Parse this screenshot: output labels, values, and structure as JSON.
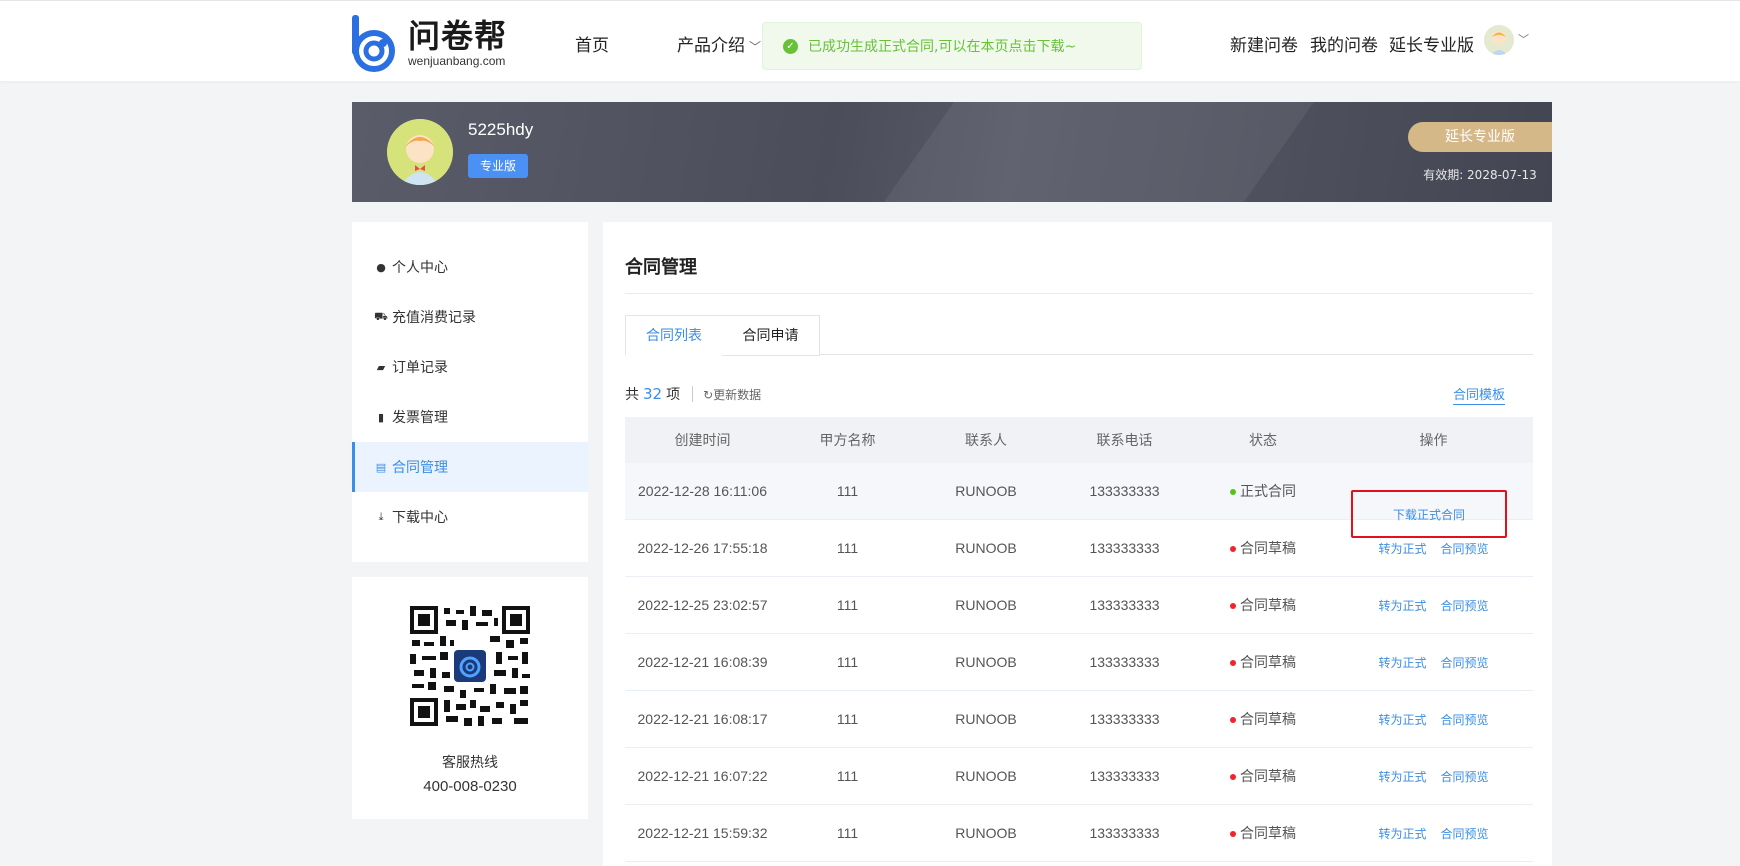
{
  "brand": {
    "name": "问卷帮",
    "domain": "wenjuanbang.com",
    "color": "#2b6fe0"
  },
  "nav": {
    "home": "首页",
    "product": "产品介绍",
    "new_survey": "新建问卷",
    "my_survey": "我的问卷",
    "extend_pro": "延长专业版"
  },
  "toast": {
    "message": "已成功生成正式合同,可以在本页点击下载~",
    "icon": "check-circle-icon",
    "color": "#67c23a"
  },
  "banner": {
    "username": "5225hdy",
    "badge": "专业版",
    "extend_button": "延长专业版",
    "validity": "有效期:  2028-07-13"
  },
  "sidebar": {
    "items": [
      {
        "label": "个人中心",
        "icon": "user-icon"
      },
      {
        "label": "充值消费记录",
        "icon": "cart-icon"
      },
      {
        "label": "订单记录",
        "icon": "ticket-icon"
      },
      {
        "label": "发票管理",
        "icon": "clipboard-icon"
      },
      {
        "label": "合同管理",
        "icon": "document-icon",
        "active": true
      },
      {
        "label": "下载中心",
        "icon": "download-icon"
      }
    ]
  },
  "support": {
    "label": "客服热线",
    "phone": "400-008-0230"
  },
  "main": {
    "title": "合同管理",
    "tabs": [
      {
        "label": "合同列表",
        "active": true
      },
      {
        "label": "合同申请"
      }
    ],
    "summary_prefix": "共",
    "summary_count": "32",
    "summary_suffix": "项",
    "refresh": "更新数据",
    "template_link": "合同模板",
    "columns": [
      "创建时间",
      "甲方名称",
      "联系人",
      "联系电话",
      "状态",
      "操作"
    ],
    "rows": [
      {
        "time": "2022-12-28 16:11:06",
        "party": "111",
        "contact": "RUNOOB",
        "phone": "133333333",
        "status": "正式合同",
        "status_color": "#52c41a",
        "actions": [
          "下载正式合同"
        ]
      },
      {
        "time": "2022-12-26 17:55:18",
        "party": "111",
        "contact": "RUNOOB",
        "phone": "133333333",
        "status": "合同草稿",
        "status_color": "#f5222d",
        "actions": [
          "转为正式",
          "合同预览"
        ]
      },
      {
        "time": "2022-12-25 23:02:57",
        "party": "111",
        "contact": "RUNOOB",
        "phone": "133333333",
        "status": "合同草稿",
        "status_color": "#f5222d",
        "actions": [
          "转为正式",
          "合同预览"
        ]
      },
      {
        "time": "2022-12-21 16:08:39",
        "party": "111",
        "contact": "RUNOOB",
        "phone": "133333333",
        "status": "合同草稿",
        "status_color": "#f5222d",
        "actions": [
          "转为正式",
          "合同预览"
        ]
      },
      {
        "time": "2022-12-21 16:08:17",
        "party": "111",
        "contact": "RUNOOB",
        "phone": "133333333",
        "status": "合同草稿",
        "status_color": "#f5222d",
        "actions": [
          "转为正式",
          "合同预览"
        ]
      },
      {
        "time": "2022-12-21 16:07:22",
        "party": "111",
        "contact": "RUNOOB",
        "phone": "133333333",
        "status": "合同草稿",
        "status_color": "#f5222d",
        "actions": [
          "转为正式",
          "合同预览"
        ]
      },
      {
        "time": "2022-12-21 15:59:32",
        "party": "111",
        "contact": "RUNOOB",
        "phone": "133333333",
        "status": "合同草稿",
        "status_color": "#f5222d",
        "actions": [
          "转为正式",
          "合同预览"
        ]
      }
    ]
  },
  "colors": {
    "accent": "#3a8ee6",
    "highlight_box": "#e0111a",
    "gold": "#d5b888"
  }
}
